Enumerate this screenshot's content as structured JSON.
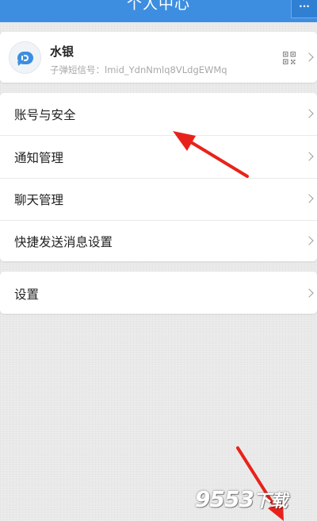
{
  "header": {
    "title": "个人中心",
    "more_label": "···"
  },
  "profile": {
    "name": "水银",
    "id_line": "子弹短信号：lmid_YdnNmlq8VLdgEWMq"
  },
  "menu": {
    "items": [
      {
        "label": "账号与安全"
      },
      {
        "label": "通知管理"
      },
      {
        "label": "聊天管理"
      },
      {
        "label": "快捷发送消息设置"
      }
    ]
  },
  "settings": {
    "label": "设置"
  },
  "watermark": {
    "number": "9553",
    "suffix": "下载"
  },
  "colors": {
    "header_blue": "#3d8ee0",
    "annotation_red": "#e8221b",
    "card_white": "#ffffff",
    "background_gray": "#e9e9e9"
  },
  "icons": [
    "more-icon",
    "avatar-chat-bubble-icon",
    "qr-code-icon",
    "chevron-right-icon",
    "red-arrow-annotation"
  ]
}
